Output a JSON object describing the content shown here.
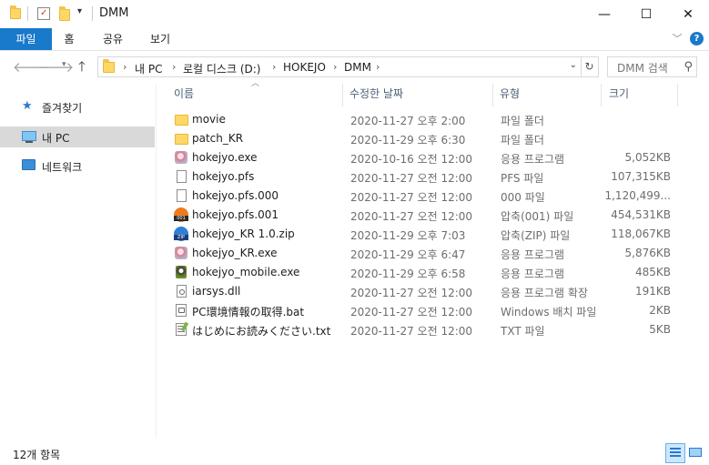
{
  "window": {
    "title": "DMM",
    "minimize": "—",
    "maximize": "☐",
    "close": "✕"
  },
  "ribbon": {
    "tabs": [
      "파일",
      "홈",
      "공유",
      "보기"
    ],
    "expand": "﹀",
    "help": "?"
  },
  "address": {
    "segments": [
      "내 PC",
      "로컬 디스크 (D:)",
      "HOKEJO",
      "DMM"
    ],
    "search_placeholder": "DMM 검색"
  },
  "nav_pane": {
    "items": [
      {
        "label": "즐겨찾기",
        "icon": "star-icon"
      },
      {
        "label": "내 PC",
        "icon": "pc-icon"
      },
      {
        "label": "네트워크",
        "icon": "network-icon"
      }
    ]
  },
  "columns": [
    "이름",
    "수정한 날짜",
    "유형",
    "크기"
  ],
  "files": [
    {
      "name": "movie",
      "date": "2020-11-27 오후 2:00",
      "type": "파일 폴더",
      "size": "",
      "icon": "folder-icon"
    },
    {
      "name": "patch_KR",
      "date": "2020-11-29 오후 6:30",
      "type": "파일 폴더",
      "size": "",
      "icon": "folder-icon"
    },
    {
      "name": "hokejyo.exe",
      "date": "2020-10-16 오전 12:00",
      "type": "응용 프로그램",
      "size": "5,052KB",
      "icon": "app-icon"
    },
    {
      "name": "hokejyo.pfs",
      "date": "2020-11-27 오전 12:00",
      "type": "PFS 파일",
      "size": "107,315KB",
      "icon": "file-icon"
    },
    {
      "name": "hokejyo.pfs.000",
      "date": "2020-11-27 오전 12:00",
      "type": "000 파일",
      "size": "1,120,499...",
      "icon": "file-icon"
    },
    {
      "name": "hokejyo.pfs.001",
      "date": "2020-11-27 오전 12:00",
      "type": "압축(001) 파일",
      "size": "454,531KB",
      "icon": "archive-001-icon"
    },
    {
      "name": "hokejyo_KR 1.0.zip",
      "date": "2020-11-29 오후 7:03",
      "type": "압축(ZIP) 파일",
      "size": "118,067KB",
      "icon": "zip-icon"
    },
    {
      "name": "hokejyo_KR.exe",
      "date": "2020-11-29 오후 6:47",
      "type": "응용 프로그램",
      "size": "5,876KB",
      "icon": "app-icon"
    },
    {
      "name": "hokejyo_mobile.exe",
      "date": "2020-11-29 오후 6:58",
      "type": "응용 프로그램",
      "size": "485KB",
      "icon": "mobile-app-icon"
    },
    {
      "name": "iarsys.dll",
      "date": "2020-11-27 오전 12:00",
      "type": "응용 프로그램 확장",
      "size": "191KB",
      "icon": "dll-icon"
    },
    {
      "name": "PC環境情報の取得.bat",
      "date": "2020-11-27 오전 12:00",
      "type": "Windows 배치 파일",
      "size": "2KB",
      "icon": "bat-icon"
    },
    {
      "name": "はじめにお読みください.txt",
      "date": "2020-11-27 오전 12:00",
      "type": "TXT 파일",
      "size": "5KB",
      "icon": "txt-icon"
    }
  ],
  "status": {
    "count": "12개 항목"
  }
}
